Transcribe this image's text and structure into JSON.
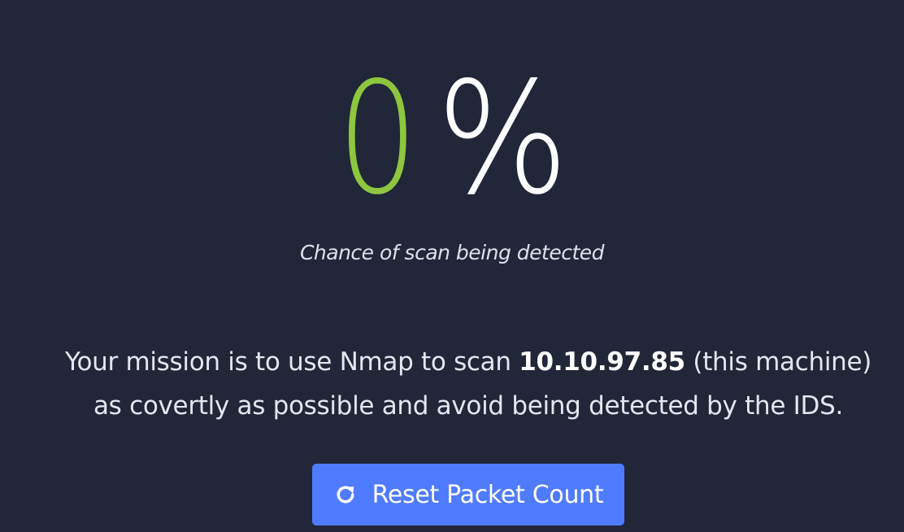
{
  "detection": {
    "value": "0",
    "unit": "%",
    "caption": "Chance of scan being detected",
    "value_color": "#8dc63f"
  },
  "mission": {
    "line1_before": "Your mission is to use Nmap to scan ",
    "ip": "10.10.97.85",
    "line1_after": " (this machine)",
    "line2": "as covertly as possible and avoid being detected by the IDS."
  },
  "reset_button": {
    "label": "Reset Packet Count",
    "icon": "refresh-icon",
    "color": "#4f7bff"
  }
}
